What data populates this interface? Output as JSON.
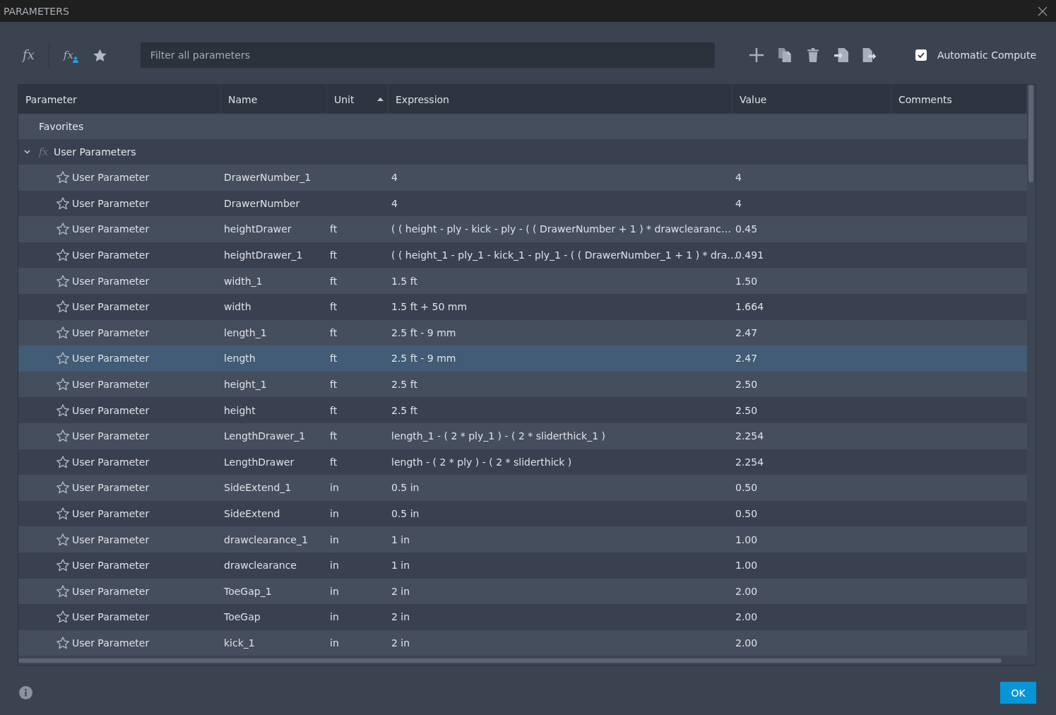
{
  "window": {
    "title": "PARAMETERS"
  },
  "toolbar": {
    "view_buttons": [
      {
        "kind": "all",
        "glyph": "fx"
      },
      {
        "kind": "user",
        "glyph": "fx"
      },
      {
        "kind": "favorites"
      }
    ],
    "filter": {
      "placeholder": "Filter all parameters"
    },
    "automatic_compute": {
      "label": "Automatic Compute",
      "checked": true
    }
  },
  "table": {
    "columns": [
      {
        "label": "Parameter",
        "sorted": false
      },
      {
        "label": "Name",
        "sorted": false
      },
      {
        "label": "Unit",
        "sorted": true
      },
      {
        "label": "Expression",
        "sorted": false
      },
      {
        "label": "Value",
        "sorted": false
      },
      {
        "label": "Comments",
        "sorted": false
      }
    ],
    "groups": [
      {
        "label": "Favorites"
      },
      {
        "label": "User Parameters",
        "glyph": "fx",
        "expanded": true,
        "children": [
          {
            "parameter": "User Parameter",
            "name": "DrawerNumber_1",
            "expression": "4",
            "value": "4",
            "favorite": false,
            "selected": false
          },
          {
            "parameter": "User Parameter",
            "name": "DrawerNumber",
            "expression": "4",
            "value": "4",
            "favorite": false,
            "selected": false
          },
          {
            "parameter": "User Parameter",
            "name": "heightDrawer",
            "unit": "ft",
            "expression": "( ( height - ply - kick - ply - ( ( DrawerNumber + 1 ) * drawclearanc…",
            "value": "0.45",
            "favorite": false,
            "selected": false
          },
          {
            "parameter": "User Parameter",
            "name": "heightDrawer_1",
            "unit": "ft",
            "expression": "( ( height_1 - ply_1 - kick_1 - ply_1 - ( ( DrawerNumber_1 + 1 ) * dra…",
            "value": "0.491",
            "favorite": false,
            "selected": false
          },
          {
            "parameter": "User Parameter",
            "name": "width_1",
            "unit": "ft",
            "expression": "1.5 ft",
            "value": "1.50",
            "favorite": false,
            "selected": false
          },
          {
            "parameter": "User Parameter",
            "name": "width",
            "unit": "ft",
            "expression": "1.5 ft + 50 mm",
            "value": "1.664",
            "favorite": false,
            "selected": false
          },
          {
            "parameter": "User Parameter",
            "name": "length_1",
            "unit": "ft",
            "expression": "2.5 ft - 9 mm",
            "value": "2.47",
            "favorite": false,
            "selected": false
          },
          {
            "parameter": "User Parameter",
            "name": "length",
            "unit": "ft",
            "expression": "2.5 ft - 9 mm",
            "value": "2.47",
            "favorite": false,
            "selected": true
          },
          {
            "parameter": "User Parameter",
            "name": "height_1",
            "unit": "ft",
            "expression": "2.5 ft",
            "value": "2.50",
            "favorite": false,
            "selected": false
          },
          {
            "parameter": "User Parameter",
            "name": "height",
            "unit": "ft",
            "expression": "2.5 ft",
            "value": "2.50",
            "favorite": false,
            "selected": false
          },
          {
            "parameter": "User Parameter",
            "name": "LengthDrawer_1",
            "unit": "ft",
            "expression": "length_1 - ( 2 * ply_1 ) - ( 2 * sliderthick_1 )",
            "value": "2.254",
            "favorite": false,
            "selected": false
          },
          {
            "parameter": "User Parameter",
            "name": "LengthDrawer",
            "unit": "ft",
            "expression": "length - ( 2 * ply ) - ( 2 * sliderthick )",
            "value": "2.254",
            "favorite": false,
            "selected": false
          },
          {
            "parameter": "User Parameter",
            "name": "SideExtend_1",
            "unit": "in",
            "expression": "0.5 in",
            "value": "0.50",
            "favorite": false,
            "selected": false
          },
          {
            "parameter": "User Parameter",
            "name": "SideExtend",
            "unit": "in",
            "expression": "0.5 in",
            "value": "0.50",
            "favorite": false,
            "selected": false
          },
          {
            "parameter": "User Parameter",
            "name": "drawclearance_1",
            "unit": "in",
            "expression": "1 in",
            "value": "1.00",
            "favorite": false,
            "selected": false
          },
          {
            "parameter": "User Parameter",
            "name": "drawclearance",
            "unit": "in",
            "expression": "1 in",
            "value": "1.00",
            "favorite": false,
            "selected": false
          },
          {
            "parameter": "User Parameter",
            "name": "ToeGap_1",
            "unit": "in",
            "expression": "2 in",
            "value": "2.00",
            "favorite": false,
            "selected": false
          },
          {
            "parameter": "User Parameter",
            "name": "ToeGap",
            "unit": "in",
            "expression": "2 in",
            "value": "2.00",
            "favorite": false,
            "selected": false
          },
          {
            "parameter": "User Parameter",
            "name": "kick_1",
            "unit": "in",
            "expression": "2 in",
            "value": "2.00",
            "favorite": false,
            "selected": false
          }
        ]
      }
    ]
  },
  "footer": {
    "button": "OK"
  }
}
